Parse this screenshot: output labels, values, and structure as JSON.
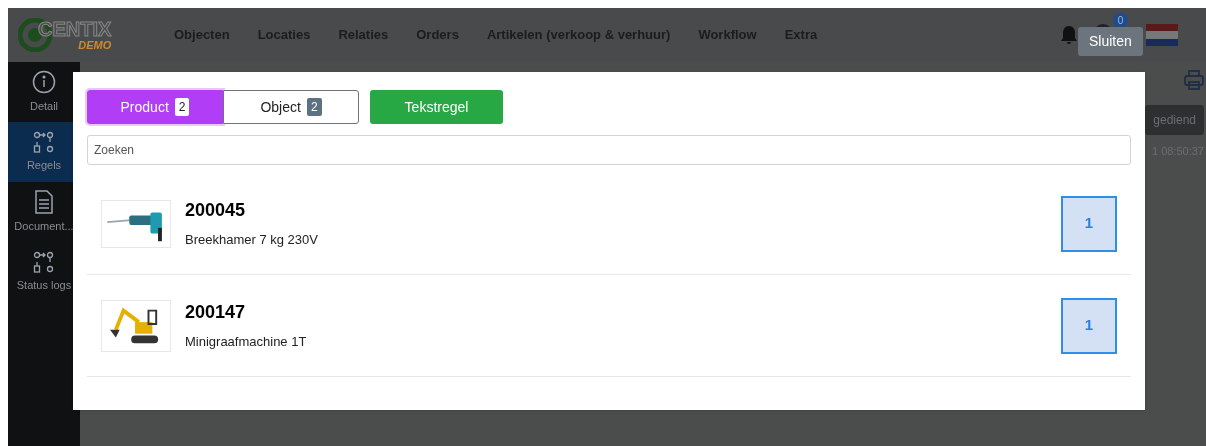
{
  "header": {
    "logo": {
      "name": "CENTIX",
      "tag": "DEMO"
    },
    "nav": [
      "Objecten",
      "Locaties",
      "Relaties",
      "Orders",
      "Artikelen (verkoop & verhuur)",
      "Workflow",
      "Extra"
    ],
    "notification_count": "0",
    "tooltip": "Sluiten"
  },
  "sidebar": {
    "items": [
      {
        "label": "Detail",
        "kind": "info",
        "selected": false
      },
      {
        "label": "Regels",
        "kind": "flow",
        "selected": true
      },
      {
        "label": "Document...",
        "kind": "doc",
        "selected": false
      },
      {
        "label": "Status logs",
        "kind": "flow",
        "selected": false
      }
    ]
  },
  "background": {
    "button": "gediend",
    "timestamp": "1 08:50:37"
  },
  "modal": {
    "tabs": [
      {
        "label": "Product",
        "count": "2",
        "selected": true
      },
      {
        "label": "Object",
        "count": "2",
        "selected": false
      }
    ],
    "action_button": "Tekstregel",
    "search": {
      "placeholder": "Zoeken"
    },
    "items": [
      {
        "code": "200045",
        "description": "Breekhamer 7 kg 230V",
        "quantity": "1",
        "kind": "drill"
      },
      {
        "code": "200147",
        "description": "Minigraafmachine 1T",
        "quantity": "1",
        "kind": "excavator"
      }
    ]
  }
}
